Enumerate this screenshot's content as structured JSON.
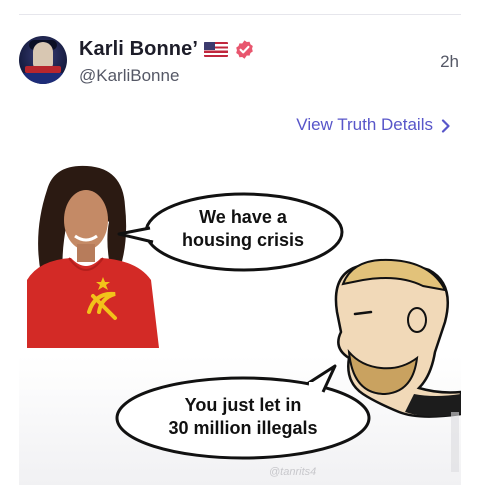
{
  "post": {
    "display_name": "Karli Bonne’",
    "handle": "@KarliBonne",
    "timestamp": "2h",
    "flag_icon": "us-flag-icon",
    "verified_icon": "verified-badge-icon",
    "verified_color": "#e8566e"
  },
  "actions": {
    "view_details": "View Truth Details",
    "link_color": "#5856c9"
  },
  "meme": {
    "bubble_top": [
      "We have a",
      "housing crisis"
    ],
    "bubble_bottom": [
      "You just let in",
      "30 million illegals"
    ],
    "watermark": "@tanrits4"
  }
}
